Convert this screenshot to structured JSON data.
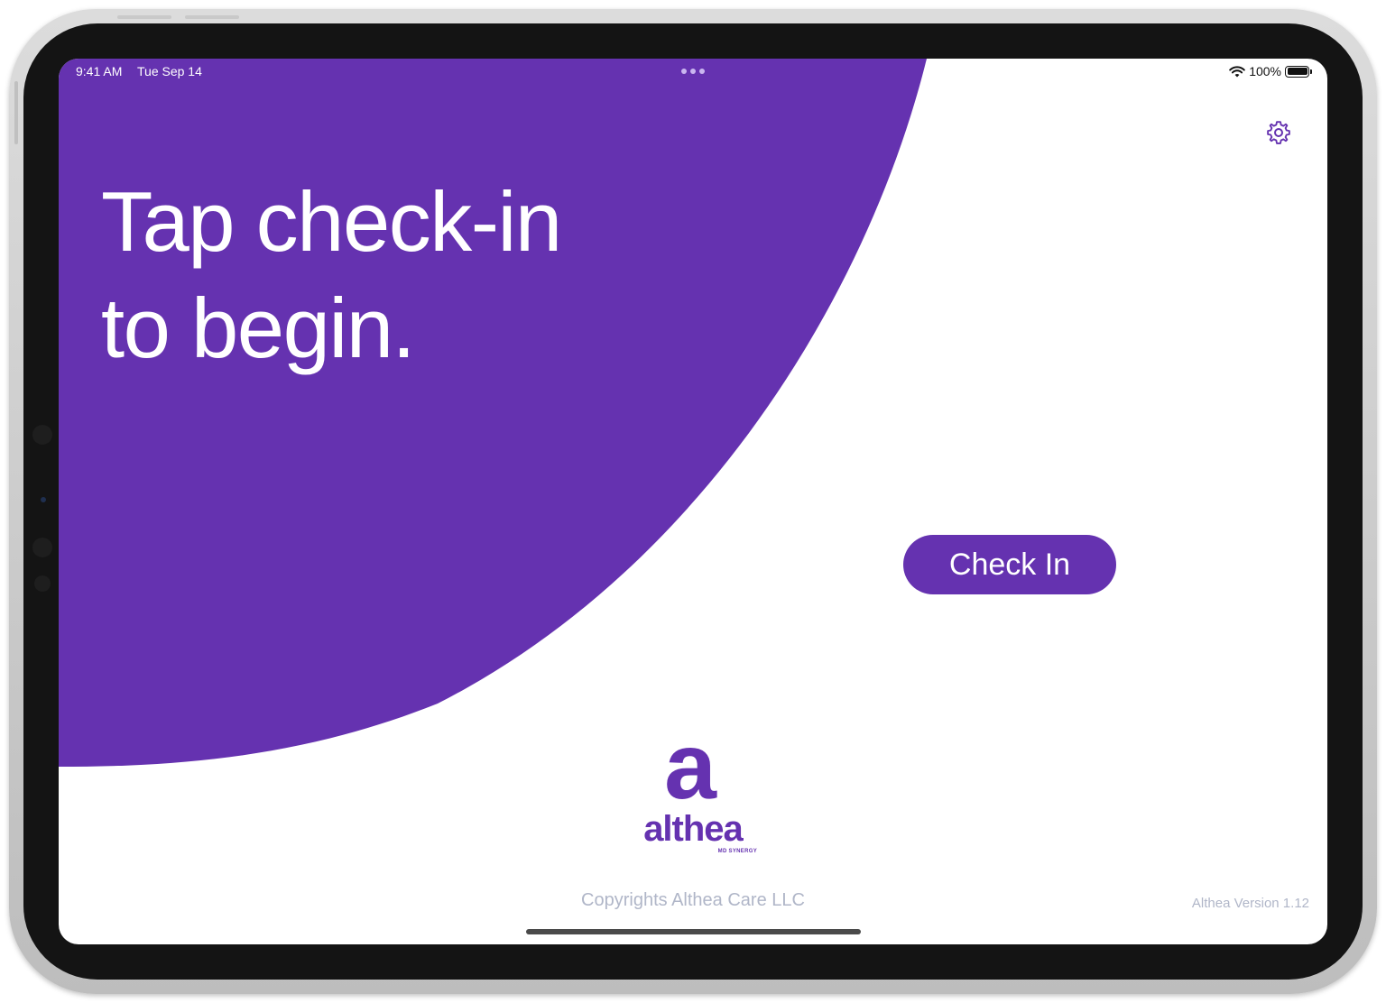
{
  "status_bar": {
    "time": "9:41 AM",
    "date": "Tue Sep 14",
    "battery_percent": "100%",
    "battery_level": 1.0,
    "wifi_icon": "wifi-icon",
    "battery_icon": "battery-icon"
  },
  "hero": {
    "line1": "Tap check-in",
    "line2": "to begin."
  },
  "toolbar": {
    "settings_icon": "gear-icon"
  },
  "check_in": {
    "label": "Check In"
  },
  "logo": {
    "mark": "a",
    "wordmark": "althea",
    "tagline": "MD SYNERGY"
  },
  "footer": {
    "copyright": "Copyrights Althea Care LLC",
    "version": "Althea Version 1.12"
  },
  "colors": {
    "brand_purple": "#6532b0",
    "background": "#ffffff",
    "muted_text": "#b0b6c8"
  }
}
